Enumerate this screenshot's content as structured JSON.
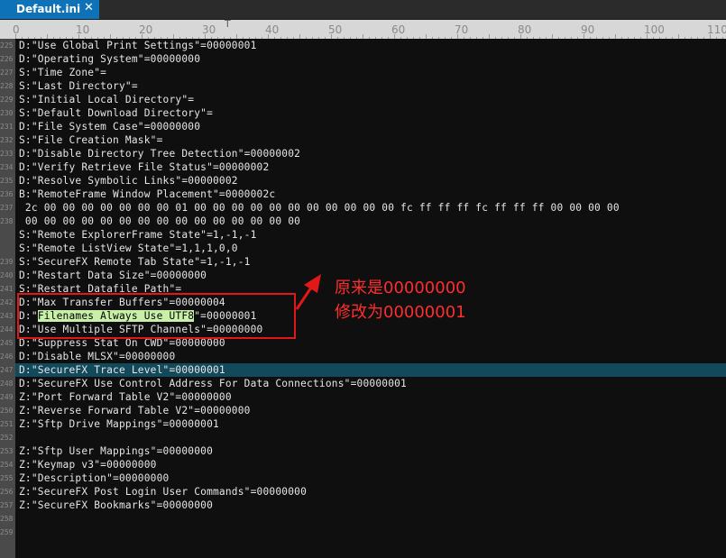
{
  "tab": {
    "title": "Default.ini",
    "close_glyph": "✕"
  },
  "ruler": {
    "labels": [
      "0",
      "10",
      "20",
      "30",
      "40",
      "50",
      "60",
      "70",
      "80",
      "90",
      "100",
      "110"
    ],
    "caret": "T"
  },
  "gutter_numbers": [
    "225",
    "226",
    "227",
    "228",
    "229",
    "230",
    "231",
    "232",
    "233",
    "234",
    "235",
    "236",
    "237",
    "238",
    "",
    "",
    "239",
    "240",
    "241",
    "242",
    "243",
    "244",
    "245",
    "246",
    "247",
    "248",
    "249",
    "250",
    "251",
    "252",
    "253",
    "254",
    "255",
    "256",
    "257",
    "258",
    "259"
  ],
  "lines": [
    "D:\"Use Global Print Settings\"=00000001",
    "D:\"Operating System\"=00000000",
    "S:\"Time Zone\"=",
    "S:\"Last Directory\"=",
    "S:\"Initial Local Directory\"=",
    "S:\"Default Download Directory\"=",
    "D:\"File System Case\"=00000000",
    "S:\"File Creation Mask\"=",
    "D:\"Disable Directory Tree Detection\"=00000002",
    "D:\"Verify Retrieve File Status\"=00000002",
    "D:\"Resolve Symbolic Links\"=00000002",
    "B:\"RemoteFrame Window Placement\"=0000002c",
    " 2c 00 00 00 00 00 00 00 01 00 00 00 00 00 00 00 00 00 00 00 fc ff ff ff fc ff ff ff 00 00 00 00",
    " 00 00 00 00 00 00 00 00 00 00 00 00 00 00 00",
    "S:\"Remote ExplorerFrame State\"=1,-1,-1",
    "S:\"Remote ListView State\"=1,1,1,0,0",
    "S:\"SecureFX Remote Tab State\"=1,-1,-1",
    "D:\"Restart Data Size\"=00000000",
    "S:\"Restart Datafile Path\"=",
    "D:\"Max Transfer Buffers\"=00000004",
    "D:\"Use Multiple SFTP Channels\"=00000000",
    "D:\"Suppress Stat On CWD\"=00000000",
    "D:\"Disable MLSX\"=00000000",
    "D:\"SecureFX Trace Level\"=00000001",
    "D:\"SecureFX Use Control Address For Data Connections\"=00000001",
    "Z:\"Port Forward Table V2\"=00000000",
    "Z:\"Reverse Forward Table V2\"=00000000",
    "Z:\"Sftp Drive Mappings\"=00000001",
    "",
    "Z:\"Sftp User Mappings\"=00000000",
    "Z:\"Keymap v3\"=00000000",
    "Z:\"Description\"=00000000",
    "Z:\"SecureFX Post Login User Commands\"=00000000",
    "Z:\"SecureFX Bookmarks\"=00000000"
  ],
  "highlighted_line": {
    "prefix": "D:\"",
    "selected": "Filenames Always Use UTF8",
    "suffix": "\"=00000001"
  },
  "annotation": {
    "line1": "原来是00000000",
    "line2": "修改为00000001",
    "color": "#ff2d2d"
  },
  "colors": {
    "tab_bg": "#0d72b8",
    "editor_bg": "#0f0f0f",
    "current_line_bg": "#124a5c",
    "selection_bg": "#c9f0a8",
    "box_border": "#e01818"
  }
}
